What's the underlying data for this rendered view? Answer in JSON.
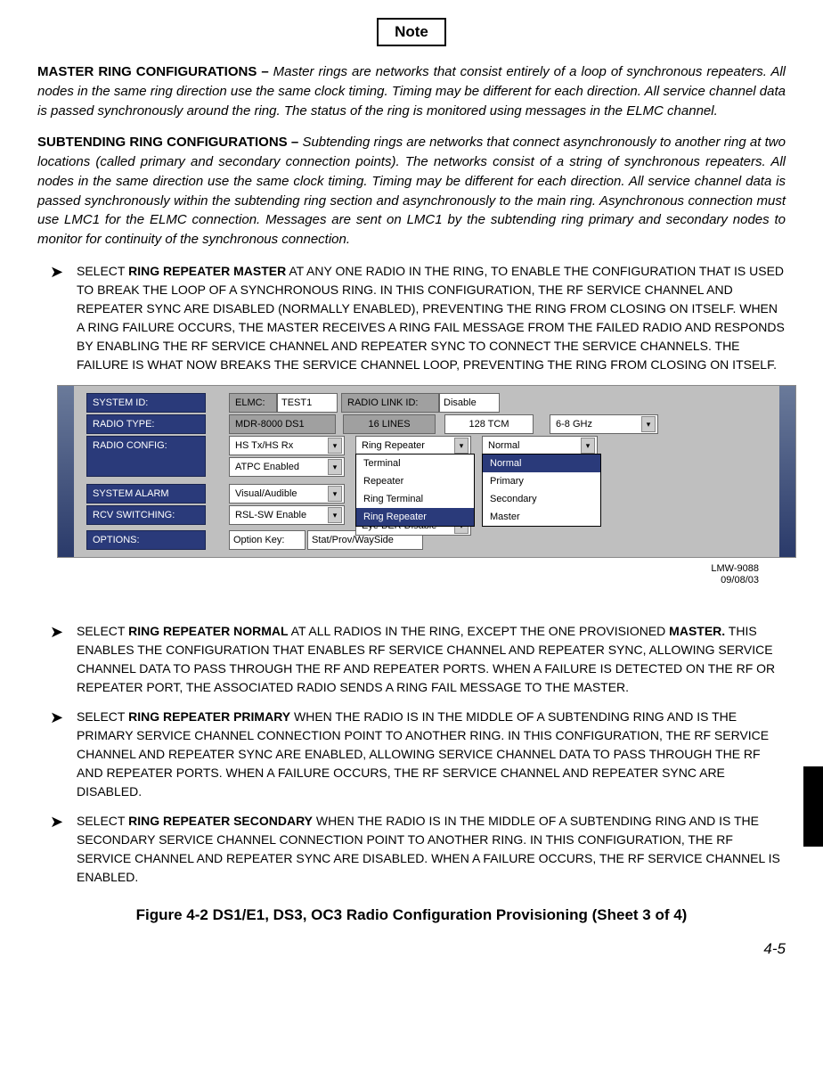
{
  "note_label": "Note",
  "para_master": {
    "lead": "MASTER RING CONFIGURATIONS – ",
    "body": "Master rings are networks that consist entirely of a loop of synchronous repeaters. All nodes in the same ring direction use the same clock timing. Timing may be different for each direction. All service channel data is passed synchronously around the ring. The status of the ring is monitored using messages in the ELMC channel."
  },
  "para_subtending": {
    "lead": "SUBTENDING RING CONFIGURATIONS – ",
    "body": "Subtending rings are networks that connect asynchronously to another ring at two locations (called primary and secondary connection points). The networks consist of a string of synchronous repeaters. All nodes in the same direction use the same clock timing. Timing may be different for each direction. All service channel data is passed synchronously within the subtending ring section and asynchronously to the main ring. Asynchronous connection must use LMC1 for the ELMC connection. Messages are sent on LMC1 by the subtending ring primary and secondary nodes to monitor for continuity of the synchronous connection."
  },
  "instr1": {
    "pre": "SELECT ",
    "bold1": "RING REPEATER MASTER",
    "rest": " AT ANY ONE RADIO IN THE RING, TO ENABLE THE CONFIGURATION THAT IS USED TO BREAK THE LOOP OF A SYNCHRONOUS RING. IN THIS CONFIGURATION, THE RF SERVICE CHANNEL AND REPEATER SYNC ARE DISABLED (NORMALLY ENABLED), PREVENTING THE RING FROM CLOSING ON ITSELF. WHEN A RING FAILURE OCCURS, THE MASTER RECEIVES A RING FAIL MESSAGE FROM THE FAILED RADIO AND RESPONDS BY ENABLING THE RF SERVICE CHANNEL AND REPEATER SYNC TO CONNECT THE SERVICE CHANNELS. THE FAILURE IS WHAT NOW BREAKS THE SERVICE CHANNEL LOOP, PREVENTING THE RING FROM CLOSING ON ITSELF."
  },
  "instr2": {
    "pre": "SELECT ",
    "bold1": "RING REPEATER NORMAL",
    "mid": " AT ALL RADIOS IN THE RING, EXCEPT THE ONE PROVISIONED ",
    "bold2": "MASTER.",
    "rest": " THIS ENABLES THE CONFIGURATION THAT ENABLES RF SERVICE CHANNEL AND REPEATER SYNC, ALLOWING SERVICE CHANNEL DATA TO PASS THROUGH THE RF AND REPEATER PORTS. WHEN A FAILURE IS DETECTED ON THE RF OR REPEATER PORT, THE ASSOCIATED RADIO SENDS A RING FAIL MESSAGE TO THE MASTER."
  },
  "instr3": {
    "pre": "SELECT ",
    "bold1": "RING REPEATER PRIMARY",
    "rest": " WHEN THE RADIO IS IN THE MIDDLE OF A SUBTENDING RING AND IS THE PRIMARY SERVICE CHANNEL CONNECTION POINT TO ANOTHER RING. IN THIS CONFIGURATION, THE RF SERVICE CHANNEL AND REPEATER SYNC ARE ENABLED, ALLOWING SERVICE CHANNEL DATA TO PASS THROUGH THE RF AND REPEATER PORTS. WHEN A FAILURE OCCURS, THE RF SERVICE CHANNEL AND REPEATER SYNC ARE DISABLED."
  },
  "instr4": {
    "pre": "SELECT ",
    "bold1": "RING REPEATER SECONDARY",
    "rest": " WHEN THE RADIO IS IN THE MIDDLE OF A SUBTENDING RING AND IS THE SECONDARY SERVICE CHANNEL CONNECTION POINT TO ANOTHER RING. IN THIS CONFIGURATION, THE RF SERVICE CHANNEL AND REPEATER SYNC ARE DISABLED. WHEN A FAILURE OCCURS, THE RF SERVICE CHANNEL IS ENABLED."
  },
  "ui": {
    "labels": {
      "system_id": "SYSTEM ID:",
      "radio_type": "RADIO TYPE:",
      "radio_config": "RADIO CONFIG:",
      "system_alarm": "SYSTEM ALARM",
      "rcv_switching": "RCV SWITCHING:",
      "options": "OPTIONS:",
      "elmc": "ELMC:",
      "radio_link_id": "RADIO LINK ID:",
      "option_key": "Option Key:"
    },
    "values": {
      "elmc": "TEST1",
      "radio_link_id": "Disable",
      "mdr": "MDR-8000 DS1",
      "lines": "16 LINES",
      "tcm": "128 TCM",
      "ghz": "6-8 GHz",
      "hs": "HS Tx/HS Rx",
      "atpc": "ATPC Enabled",
      "ring": "Ring Repeater",
      "normal": "Normal",
      "visual": "Visual/Audible",
      "rsl": "RSL-SW Enable",
      "eye": "Eye BER Disable",
      "stat": "Stat/Prov/WaySide"
    },
    "ring_list": [
      "Terminal",
      "Repeater",
      "Ring Terminal",
      "Ring Repeater"
    ],
    "normal_list": [
      "Normal",
      "Primary",
      "Secondary",
      "Master"
    ]
  },
  "doc_ref": {
    "id": "LMW-9088",
    "date": "09/08/03"
  },
  "figure_caption": "Figure 4-2  DS1/E1, DS3, OC3 Radio Configuration Provisioning (Sheet 3 of 4)",
  "page_number": "4-5"
}
